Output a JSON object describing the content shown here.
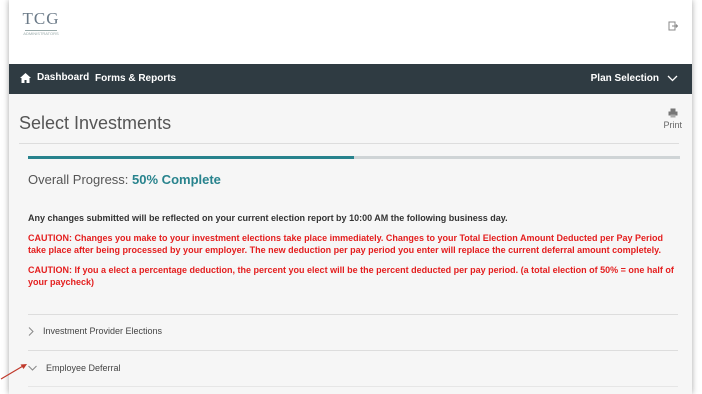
{
  "header": {
    "logo_text": "TCG",
    "logo_subtext": "ADMINISTRATORS"
  },
  "nav": {
    "dashboard": "Dashboard",
    "forms_reports": "Forms & Reports",
    "plan_selection": "Plan Selection"
  },
  "page": {
    "title": "Select Investments",
    "print_label": "Print"
  },
  "progress": {
    "label_prefix": "Overall Progress:",
    "percent_text": "50% Complete",
    "value": 0.5
  },
  "notices": {
    "info": "Any changes submitted will be reflected on your current election report by 10:00 AM the following business day.",
    "caution1": "CAUTION: Changes you make to your investment elections take place immediately. Changes to your Total Election Amount Deducted per Pay Period take place after being processed by your employer. The new deduction per pay period you enter will replace the current deferral amount completely.",
    "caution2": "CAUTION: If you a elect a percentage deduction, the percent you elect will be the percent deducted per pay period. (a total election of 50% = one half of your paycheck)"
  },
  "sections": [
    {
      "label": "Investment Provider Elections",
      "expanded": false
    },
    {
      "label": "Employee Deferral",
      "expanded": true
    }
  ],
  "colors": {
    "nav_bg": "#2f3b42",
    "accent": "#28838d",
    "caution": "#e41e1e",
    "pointer": "#c0392b"
  }
}
